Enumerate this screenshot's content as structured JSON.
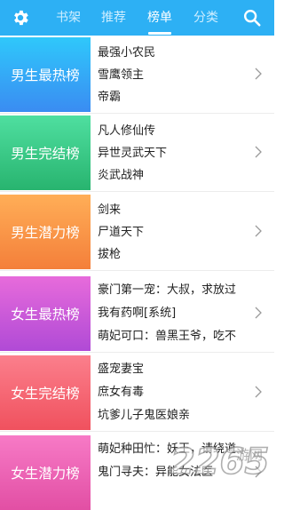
{
  "header": {
    "tabs": [
      {
        "label": "书架",
        "active": false
      },
      {
        "label": "推荐",
        "active": false
      },
      {
        "label": "榜单",
        "active": true
      },
      {
        "label": "分类",
        "active": false
      }
    ],
    "settings_icon": "gear-icon",
    "search_icon": "search-icon",
    "bg_color": "#2db0f4"
  },
  "rankings": [
    {
      "title": "男生最热榜",
      "books": [
        "最强小农民",
        "雪鹰领主",
        "帝霸"
      ],
      "color_top": "#2fc8fb",
      "color_bottom": "#3a8cf2"
    },
    {
      "title": "男生完结榜",
      "books": [
        "凡人修仙传",
        "异世灵武天下",
        "炎武战神"
      ],
      "color_top": "#4fdfa0",
      "color_bottom": "#28b46f"
    },
    {
      "title": "男生潜力榜",
      "books": [
        "剑来",
        "尸道天下",
        "拔枪"
      ],
      "color_top": "#ffae57",
      "color_bottom": "#f47f3a"
    },
    {
      "title": "女生最热榜",
      "books": [
        "豪门第一宠：大叔，求放过",
        "我有药啊[系统]",
        "萌妃可口：兽黑王爷，吃不"
      ],
      "color_top": "#e76bdb",
      "color_bottom": "#b04ad6"
    },
    {
      "title": "女生完结榜",
      "books": [
        "盛宠妻宝",
        "庶女有毒",
        "坑爹儿子鬼医娘亲"
      ],
      "color_top": "#fb7f8c",
      "color_bottom": "#f0515e"
    },
    {
      "title": "女生潜力榜",
      "books": [
        "萌妃种田忙：妖王，请绕道",
        "鬼门寻夫：异能女法医"
      ],
      "color_top": "#f77ac6",
      "color_bottom": "#e24fa4"
    }
  ],
  "watermark": {
    "text": "游网",
    "brand": "2265"
  }
}
